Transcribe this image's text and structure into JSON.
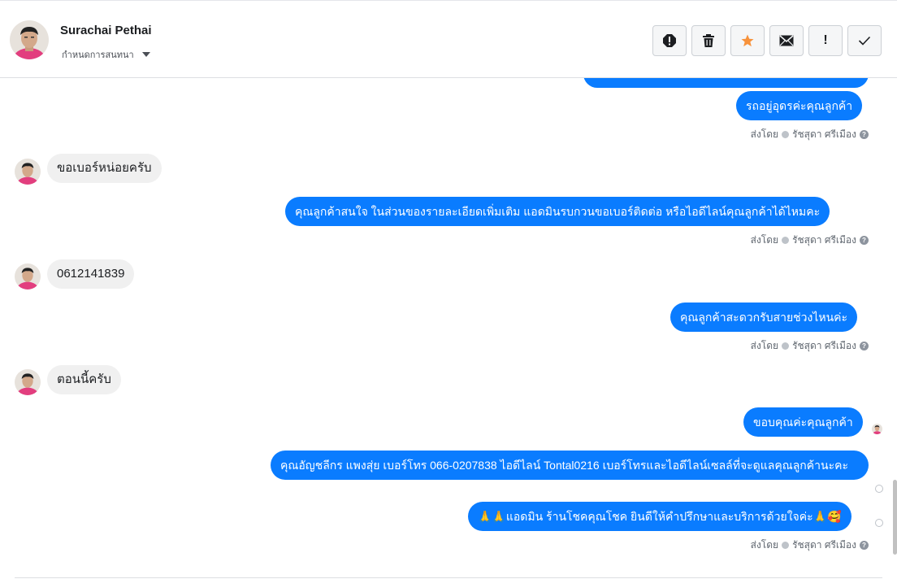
{
  "header": {
    "name": "Surachai Pethai",
    "assign_label": "กำหนดการสนทนา",
    "tools": [
      {
        "icon": "alert-circle-icon"
      },
      {
        "icon": "trash-icon"
      },
      {
        "icon": "star-icon"
      },
      {
        "icon": "mail-icon"
      },
      {
        "icon": "exclamation-icon",
        "label": "!"
      },
      {
        "icon": "check-icon"
      }
    ],
    "star_color": "#f7923b"
  },
  "messages": {
    "out_1": "รถอยู่อุดรค่ะคุณลูกค้า",
    "in_1": "ขอเบอร์หน่อยครับ",
    "out_2": "คุณลูกค้าสนใจ ในส่วนของรายละเอียดเพิ่มเติม แอดมินรบกวนขอเบอร์ติดต่อ หรือไอดีไลน์คุณลูกค้าได้ไหมคะ",
    "in_2": "0612141839",
    "out_3": "คุณลูกค้าสะดวกรับสายช่วงไหนค่ะ",
    "in_3": "ตอนนี้ครับ",
    "out_4": "ขอบคุณค่ะคุณลูกค้า",
    "out_5": "คุณอัญชลีกร แพงสุ่ย      เบอร์โทร 066-0207838 ไอดีไลน์ Tontal0216  เบอร์โทรและไอดีไลน์เซลล์ที่จะดูแลคุณลูกค้านะคะ",
    "out_6": "🙏🙏แอดมิน ร้านโชคคุณโชค ยินดีให้คำปรึกษาและบริการด้วยใจค่ะ🙏🥰"
  },
  "sent_by": {
    "prefix": "ส่งโดย",
    "agent": "รัชสุดา ศรีเมือง",
    "help": "?"
  },
  "colors": {
    "accent": "#0a7cff",
    "incoming": "#f0f0f0"
  }
}
